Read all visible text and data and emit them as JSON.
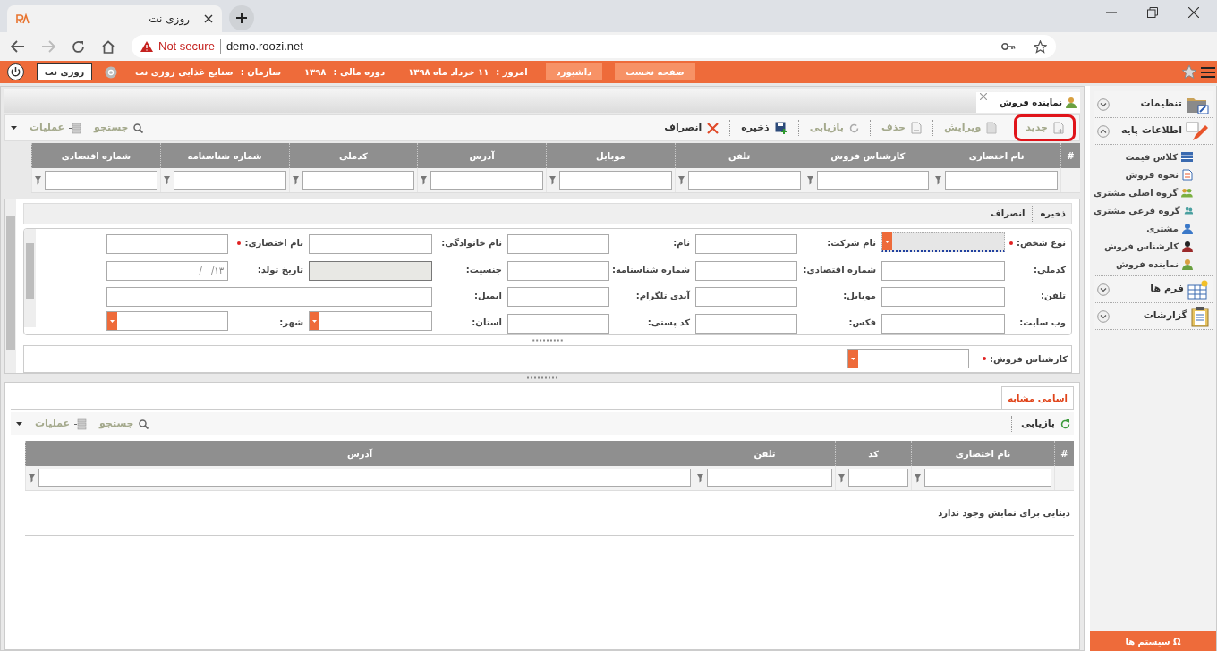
{
  "browser": {
    "tab_title": "روزی نت",
    "security": "Not secure",
    "url": "demo.roozi.net"
  },
  "header": {
    "buttons": [
      "صفحه نخست",
      "داشبورد"
    ],
    "info": [
      {
        "label": "امروز :",
        "value": "۱۱ خرداد ماه ۱۳۹۸"
      },
      {
        "label": "دوره مالی :",
        "value": "۱۳۹۸"
      },
      {
        "label": "سازمان :",
        "value": "صنایع غذایی روزی نت"
      }
    ],
    "user": "روزی نت"
  },
  "page_tabs": [
    {
      "label": "نماینده فروش",
      "selected": true
    }
  ],
  "toolbar": {
    "actions": [
      {
        "label": "جدید",
        "kind": "new",
        "disabled": true,
        "highlighted": true
      },
      {
        "label": "ویرایش",
        "kind": "edit",
        "disabled": true,
        "highlighted": false
      },
      {
        "label": "حذف",
        "kind": "delete",
        "disabled": true,
        "highlighted": false
      },
      {
        "label": "بازیابی",
        "kind": "refresh",
        "disabled": true,
        "highlighted": false
      },
      {
        "label": "ذخیره",
        "kind": "save",
        "disabled": false,
        "highlighted": false
      },
      {
        "label": "انصراف",
        "kind": "cancel",
        "disabled": false,
        "highlighted": false
      }
    ],
    "tools": [
      {
        "label": "جستجو",
        "kind": "search"
      },
      {
        "label": "عملیات",
        "kind": "operations"
      }
    ]
  },
  "grid": {
    "columns": [
      "#",
      "نام اختصاری",
      "کارشناس فروش",
      "تلفن",
      "موبایل",
      "آدرس",
      "کدملی",
      "شماره شناسنامه",
      "شماره اقتصادی"
    ]
  },
  "form": {
    "actions": [
      "ذخیره",
      "انصراف"
    ],
    "rows": [
      [
        {
          "label": "نوع شخص:",
          "required": true,
          "kind": "select",
          "focused": true
        },
        {
          "label": "نام شرکت:",
          "kind": "text"
        },
        {
          "label": "نام:",
          "kind": "text"
        },
        {
          "label": "نام خانوادگی:",
          "kind": "text"
        },
        {
          "label": "نام اختصاری:",
          "required": true,
          "kind": "text"
        }
      ],
      [
        {
          "label": "کدملی:",
          "kind": "text"
        },
        {
          "label": "شماره اقتصادی:",
          "kind": "text"
        },
        {
          "label": "شماره شناسنامه:",
          "kind": "text"
        },
        {
          "label": "جنسیت:",
          "kind": "readonly"
        },
        {
          "label": "تاریخ تولد:",
          "kind": "text",
          "placeholder": "__/__/۱۳"
        }
      ],
      [
        {
          "label": "تلفن:",
          "kind": "text"
        },
        {
          "label": "موبایل:",
          "kind": "text"
        },
        {
          "label": "آیدی تلگرام:",
          "kind": "text"
        },
        {
          "label": "ایمیل:",
          "kind": "wide"
        }
      ],
      [
        {
          "label": "وب سایت:",
          "kind": "text"
        },
        {
          "label": "فکس:",
          "kind": "text"
        },
        {
          "label": "کد پستی:",
          "kind": "text"
        },
        {
          "label": "استان:",
          "kind": "select"
        },
        {
          "label": "شهر:",
          "kind": "select"
        }
      ]
    ],
    "extra": [
      {
        "label": "کارشناس فروش:",
        "required": true,
        "kind": "select"
      }
    ]
  },
  "similar": {
    "tabs": [
      {
        "label": "اسامی مشابه",
        "selected": true
      }
    ],
    "actions": [
      {
        "label": "بازیابی",
        "kind": "refresh"
      }
    ],
    "tools": [
      {
        "label": "جستجو",
        "kind": "search"
      },
      {
        "label": "عملیات",
        "kind": "operations"
      }
    ],
    "columns": [
      "#",
      "نام اختصاری",
      "کد",
      "تلفن",
      "آدرس"
    ],
    "empty_message": "دیتایی برای نمایش وجود ندارد"
  },
  "sidebar": {
    "groups": [
      {
        "label": "تنظیمات",
        "kind": "settings",
        "expanded": false
      },
      {
        "label": "اطلاعات پایه",
        "kind": "base",
        "expanded": true,
        "children": [
          {
            "label": "کلاس قیمت",
            "kind": "grid"
          },
          {
            "label": "نحوه فروش",
            "kind": "doc"
          },
          {
            "label": "گروه اصلی مشتری",
            "kind": "group"
          },
          {
            "label": "گروه فرعی مشتری",
            "kind": "subgroup"
          },
          {
            "label": "مشتری",
            "kind": "person"
          },
          {
            "label": "کارشناس فروش",
            "kind": "expert"
          },
          {
            "label": "نماینده فروش",
            "kind": "agent"
          }
        ]
      },
      {
        "label": "فرم ها",
        "kind": "forms",
        "expanded": false
      },
      {
        "label": "گزارشات",
        "kind": "reports",
        "expanded": false
      }
    ],
    "footer": {
      "glyph": "Ω",
      "label": "سیستم ها"
    }
  }
}
